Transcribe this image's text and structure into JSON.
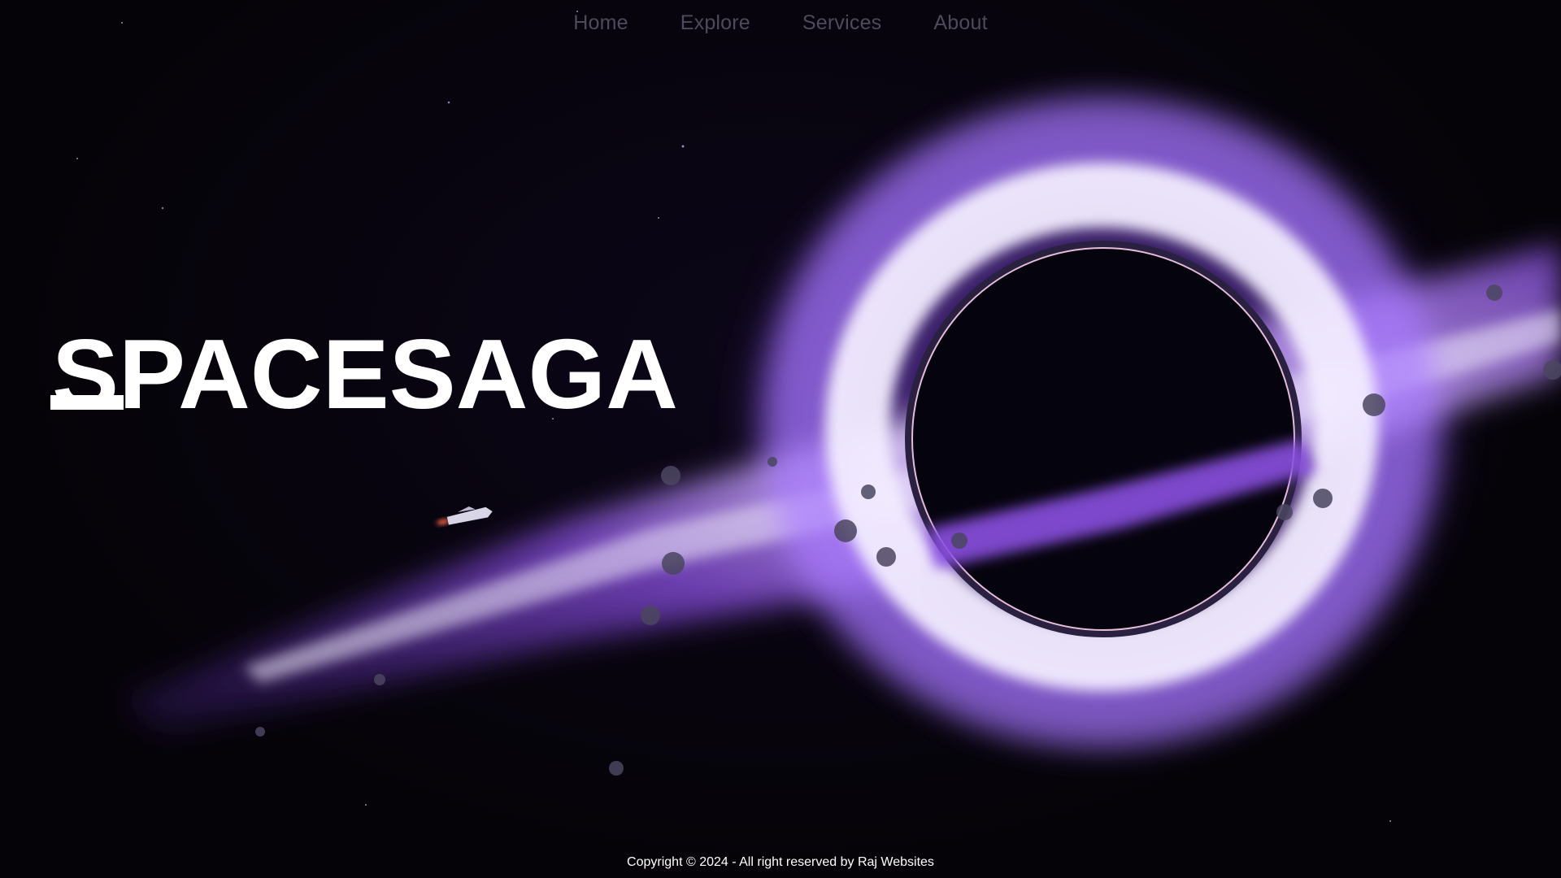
{
  "nav": {
    "items": [
      {
        "label": "Home"
      },
      {
        "label": "Explore"
      },
      {
        "label": "Services"
      },
      {
        "label": "About"
      }
    ]
  },
  "hero": {
    "logo_text": "SPACESAGA"
  },
  "footer": {
    "copyright": "Copyright © 2024 - All right reserved by Raj Websites"
  },
  "colors": {
    "accent_purple": "#8a4fe0",
    "glow_white": "#f3ecff",
    "background": "#05030d"
  }
}
